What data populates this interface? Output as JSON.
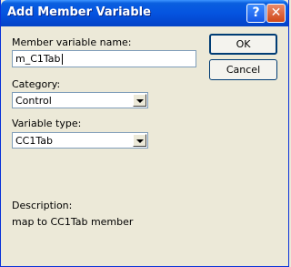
{
  "window": {
    "title": "Add Member Variable"
  },
  "titlebar": {
    "help_glyph": "?",
    "close_glyph": "✕"
  },
  "form": {
    "name_label": "Member variable name:",
    "name_value": "m_C1Tab",
    "category_label": "Category:",
    "category_value": "Control",
    "type_label": "Variable type:",
    "type_value": "CC1Tab",
    "description_label": "Description:",
    "description_text": "map to CC1Tab member"
  },
  "buttons": {
    "ok": "OK",
    "cancel": "Cancel"
  }
}
